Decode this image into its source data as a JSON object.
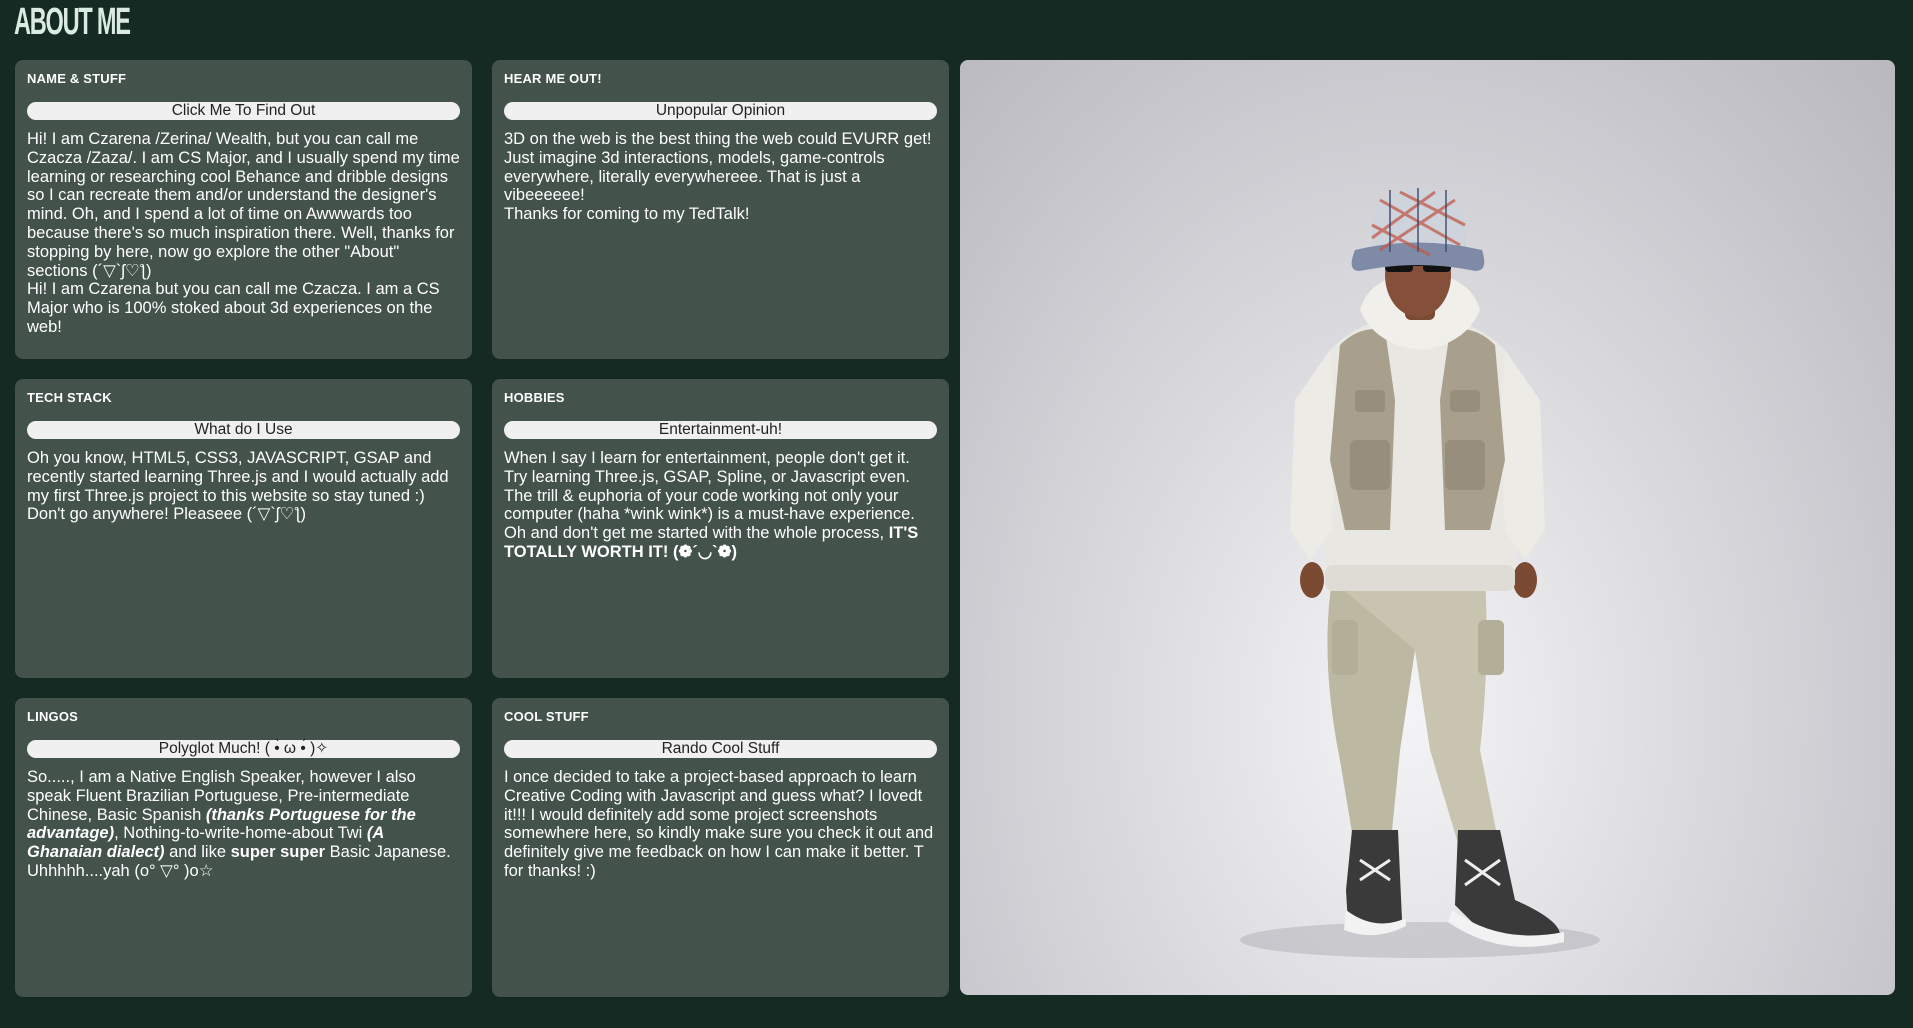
{
  "page": {
    "title": "ABOUT ME"
  },
  "cards": {
    "name": {
      "title": "NAME & STUFF",
      "button": "Click Me To Find Out",
      "text": "Hi! I am Czarena /Zerina/ Wealth, but you can call me Czacza /Zaza/. I am CS Major, and I usually spend my time learning or researching cool Behance and dribble designs so I can recreate them and/or understand the designer's mind. Oh, and I spend a lot of time on Awwwards too because there's so much inspiration there. Well, thanks for stopping by here, now go explore the other \"About\" sections (´▽`ʃ♡ƪ)",
      "text2": "Hi! I am Czarena but you can call me Czacza. I am a CS Major who is 100% stoked about 3d experiences on the web!"
    },
    "opinion": {
      "title": "HEAR ME OUT!",
      "button": "Unpopular Opinion",
      "text": "3D on the web is the best thing the web could EVURR get! Just imagine 3d interactions, models, game-controls everywhere, literally everywhereee. That is just a vibeeeeee!",
      "text2": "Thanks for coming to my TedTalk!"
    },
    "tech": {
      "title": "TECH STACK",
      "button": "What do I Use",
      "text": "Oh you know, HTML5, CSS3, JAVASCRIPT, GSAP and recently started learning Three.js and I would actually add my first Three.js project to this website so stay tuned :) Don't go anywhere! Pleaseee (´▽`ʃ♡ƪ)"
    },
    "hobbies": {
      "title": "HOBBIES",
      "button": "Entertainment-uh!",
      "text": "When I say I learn for entertainment, people don't get it. Try learning Three.js, GSAP, Spline, or Javascript even. The trill & euphoria of your code working not only your computer (haha *wink wink*) is a must-have experience. Oh and don't get me started with the whole process, ",
      "text_bold": "IT'S TOTALLY WORTH IT! (❁´◡`❁)"
    },
    "lingos": {
      "title": "LINGOS",
      "button": "Polyglot Much! ( •̀ ω •́ )✧",
      "t1": "So....., I am a Native English Speaker, however I also speak Fluent Brazilian Portuguese, Pre-intermediate Chinese, Basic Spanish ",
      "t2": "(thanks Portuguese for the advantage)",
      "t3": ", Nothing-to-write-home-about Twi ",
      "t4": "(A Ghanaian dialect)",
      "t5": " and like ",
      "t6": "super super",
      "t7": " Basic Japanese. Uhhhhh....yah (o° ▽° )o☆"
    },
    "cool": {
      "title": "COOL STUFF",
      "button": "Rando Cool Stuff",
      "text": "I once decided to take a project-based approach to learn Creative Coding with Javascript and guess what? I lovedt it!!! I would definitely add some project screenshots somewhere here, so kindly make sure you check it out and definitely give me feedback on how I can make it better. T for thanks! :)"
    }
  },
  "viewer": {
    "label": "3d-avatar"
  }
}
